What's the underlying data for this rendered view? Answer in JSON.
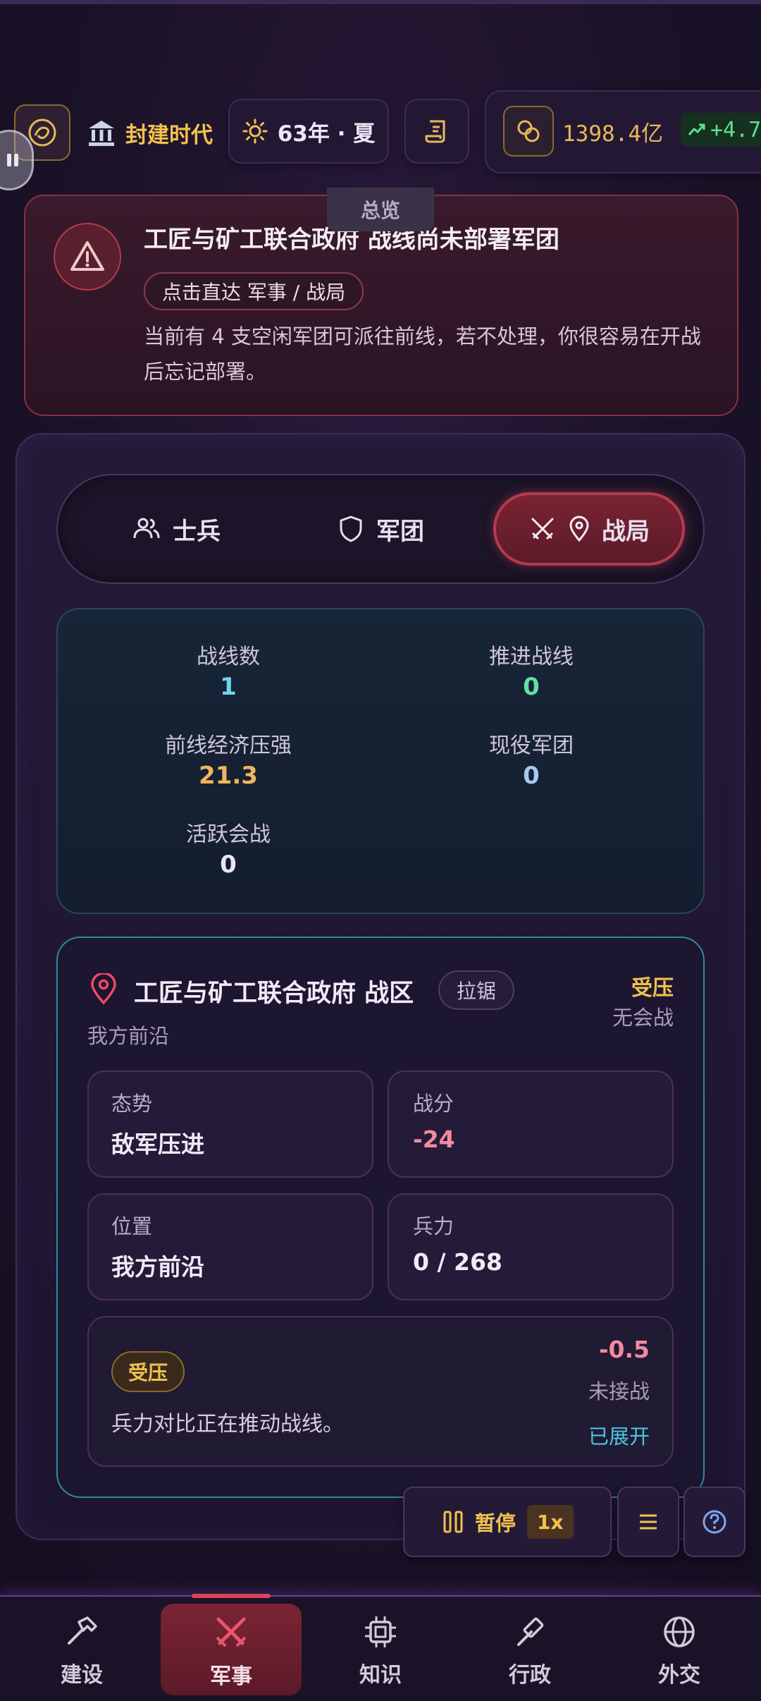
{
  "header": {
    "era_icon": "dragon-emblem-icon",
    "era_label": "封建时代",
    "date_label": "63年 · 夏",
    "gold_value": "1398.4亿",
    "gold_delta": "+4.7"
  },
  "overview_tab": "总览",
  "alert": {
    "title": "工匠与矿工联合政府 战线尚未部署军团",
    "link": "点击直达 军事 / 战局",
    "body": "当前有 4 支空闲军团可派往前线，若不处理，你很容易在开战后忘记部署。"
  },
  "tabs": [
    {
      "label": "士兵",
      "icon": "soldiers-icon"
    },
    {
      "label": "军团",
      "icon": "shield-icon"
    },
    {
      "label": "战局",
      "icon": "crossed-swords-icon",
      "active": true
    }
  ],
  "stats": {
    "front_count_label": "战线数",
    "front_count": "1",
    "advancing_label": "推进战线",
    "advancing": "0",
    "pressure_label": "前线经济压强",
    "pressure": "21.3",
    "legions_label": "现役军团",
    "legions": "0",
    "battles_label": "活跃会战",
    "battles": "0"
  },
  "zone": {
    "title": "工匠与矿工联合政府 战区",
    "tag": "拉锯",
    "subtitle": "我方前沿",
    "status": "受压",
    "combat": "无会战",
    "cards": {
      "posture_label": "态势",
      "posture": "敌军压进",
      "score_label": "战分",
      "score": "-24",
      "position_label": "位置",
      "position": "我方前沿",
      "force_label": "兵力",
      "force": "0 / 268"
    },
    "pressure": {
      "badge": "受压",
      "text": "兵力对比正在推动战线。",
      "value": "-0.5",
      "engage": "未接战",
      "expand": "已展开"
    }
  },
  "controls": {
    "pause_label": "暂停",
    "speed": "1x"
  },
  "nav": [
    {
      "label": "建设",
      "icon": "hammer-icon"
    },
    {
      "label": "军事",
      "icon": "crossed-swords-icon",
      "active": true
    },
    {
      "label": "知识",
      "icon": "chip-icon"
    },
    {
      "label": "行政",
      "icon": "gavel-icon"
    },
    {
      "label": "外交",
      "icon": "globe-icon"
    }
  ],
  "colors": {
    "accent_gold": "#f2c14e",
    "accent_red": "#b33c50",
    "accent_cyan": "#2c8aa0",
    "positive_green": "#5fe08f",
    "negative_pink": "#f28aa0"
  }
}
